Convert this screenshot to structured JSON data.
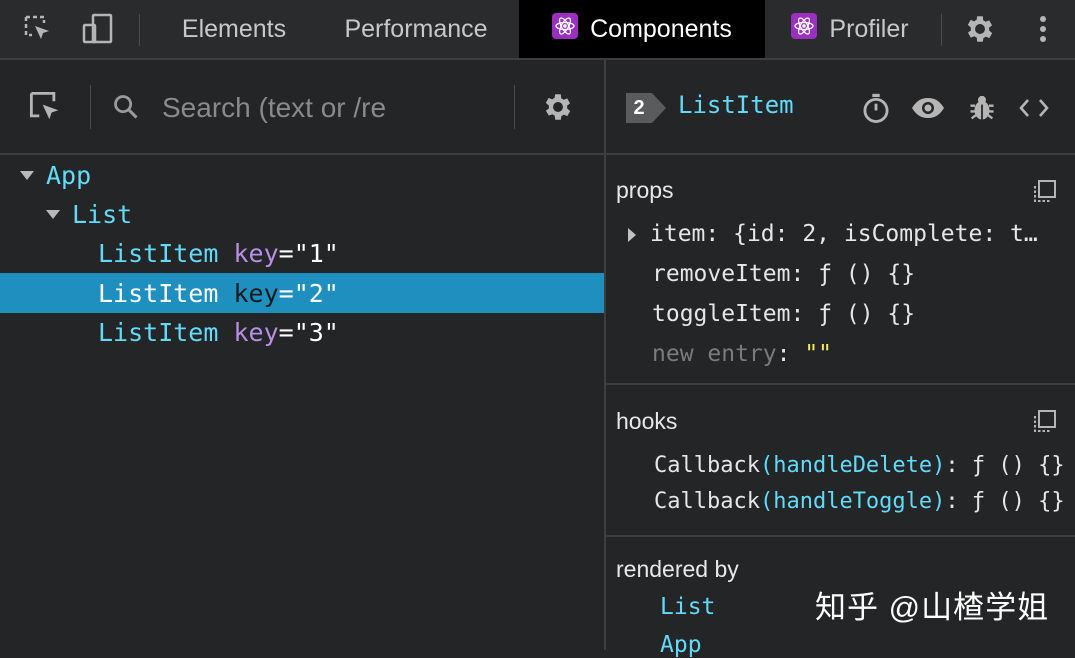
{
  "topbar": {
    "tabs": [
      {
        "label": "Elements"
      },
      {
        "label": "Performance"
      },
      {
        "label": "Components"
      },
      {
        "label": "Profiler"
      }
    ],
    "active_tab": "Components"
  },
  "search": {
    "placeholder": "Search (text or /re"
  },
  "tree": {
    "rows": [
      {
        "name": "App"
      },
      {
        "name": "List"
      },
      {
        "name": "ListItem",
        "key_label": "key",
        "key_value": "\"1\""
      },
      {
        "name": "ListItem",
        "key_label": "key",
        "key_value": "\"2\""
      },
      {
        "name": "ListItem",
        "key_label": "key",
        "key_value": "\"3\""
      }
    ],
    "selected_index": 3
  },
  "inspector": {
    "badge": "2",
    "title": "ListItem",
    "props": {
      "title": "props",
      "items": [
        {
          "key": "item",
          "sep": ": ",
          "value": "{id: 2, isComplete: t…"
        },
        {
          "key": "removeItem",
          "sep": ": ",
          "value": "ƒ () {}"
        },
        {
          "key": "toggleItem",
          "sep": ": ",
          "value": "ƒ () {}"
        }
      ],
      "new_entry_label": "new entry",
      "new_entry_sep": ": ",
      "new_entry_value": "\"\""
    },
    "hooks": {
      "title": "hooks",
      "items": [
        {
          "name": "Callback",
          "open": "(",
          "arg": "handleDelete",
          "close": ")",
          "sep": ": ",
          "value": "ƒ () {}"
        },
        {
          "name": "Callback",
          "open": "(",
          "arg": "handleToggle",
          "close": ")",
          "sep": ": ",
          "value": "ƒ () {}"
        }
      ]
    },
    "rendered_by": {
      "title": "rendered by",
      "items": [
        "List",
        "App"
      ]
    }
  },
  "watermark": "知乎 @山楂学姐",
  "colors": {
    "accent": "#61dafb",
    "selection": "#1f8fbf",
    "key_attr": "#b88ee8",
    "string_empty": "#f5e663",
    "react_logo_bg": "#9b2fbf"
  }
}
